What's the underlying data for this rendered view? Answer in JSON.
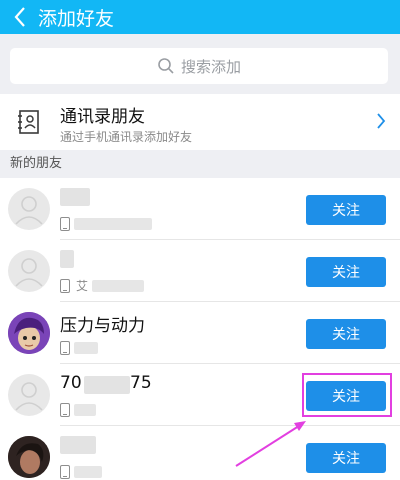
{
  "header": {
    "title": "添加好友",
    "back_icon": "back-icon",
    "background": "#12b7f5"
  },
  "search": {
    "placeholder": "搜索添加",
    "icon": "search-icon"
  },
  "contacts": {
    "title": "通讯录朋友",
    "subtitle": "通过手机通讯录添加好友",
    "icon": "contacts-book-icon"
  },
  "section": {
    "title": "新的朋友"
  },
  "friends": [
    {
      "name": "",
      "sub": "",
      "button": "关注"
    },
    {
      "name": "",
      "sub": "艾",
      "button": "关注"
    },
    {
      "name": "压力与动力",
      "sub": "",
      "button": "关注"
    },
    {
      "name": "70",
      "name_suffix": "75",
      "sub": "",
      "button": "关注"
    },
    {
      "name": "",
      "sub": "",
      "button": "关注"
    }
  ],
  "colors": {
    "accent": "#1e8fe8",
    "highlight": "#e23fe0"
  }
}
